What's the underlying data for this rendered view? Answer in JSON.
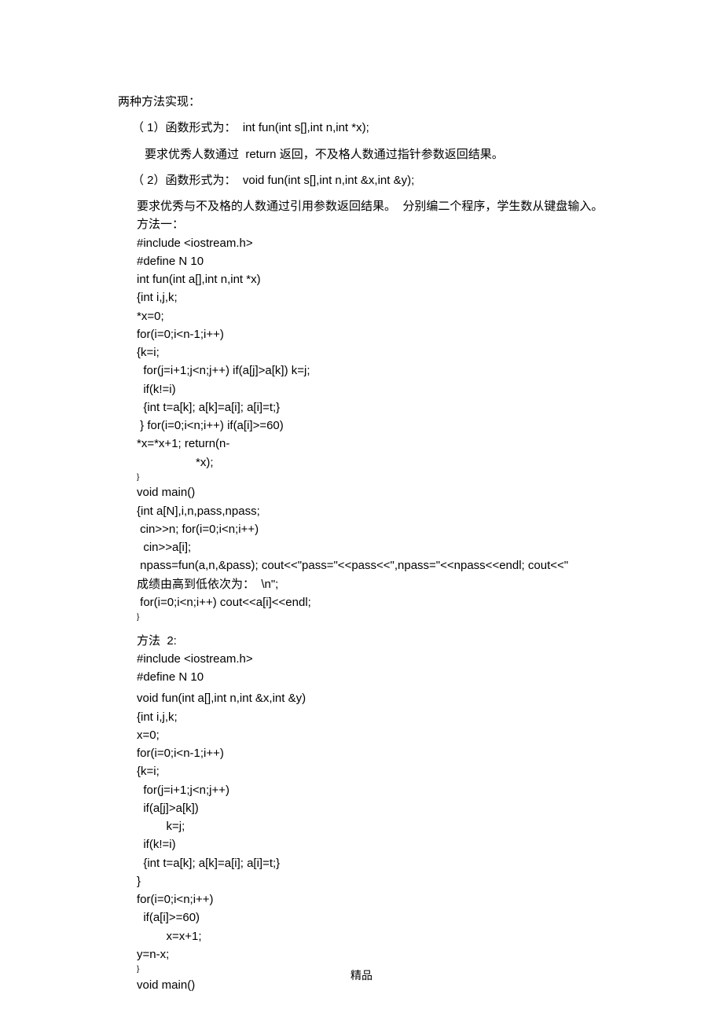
{
  "intro": "两种方法实现：",
  "item1_a": "（ 1）函数形式为：  int fun(int s[],int n,int *x);",
  "item1_b": "要求优秀人数通过  return 返回，不及格人数通过指针参数返回结果。",
  "item2_a": "（ 2）函数形式为：  void fun(int s[],int n,int &x,int &y);",
  "item2_b": "要求优秀与不及格的人数通过引用参数返回结果。  分别编二个程序，学生数从键盘输入。",
  "m1_label": "方法一：",
  "m1_code": [
    "#include <iostream.h>",
    "#define N 10",
    "int fun(int a[],int n,int *x)",
    "{int i,j,k;",
    "*x=0;",
    "for(i=0;i<n-1;i++)",
    "{k=i;",
    "  for(j=i+1;j<n;j++) if(a[j]>a[k]) k=j;",
    "  if(k!=i)",
    "  {int t=a[k]; a[k]=a[i]; a[i]=t;}",
    " } for(i=0;i<n;i++) if(a[i]>=60)",
    "*x=*x+1; return(n-",
    "                  *x);",
    "}",
    "void main()",
    "{int a[N],i,n,pass,npass;",
    " cin>>n; for(i=0;i<n;i++)",
    "  cin>>a[i];",
    " npass=fun(a,n,&pass); cout<<\"pass=\"<<pass<<\",npass=\"<<npass<<endl; cout<<\"",
    "成绩由高到低依次为：  \\n\";",
    " for(i=0;i<n;i++) cout<<a[i]<<endl;",
    "}"
  ],
  "m2_label": "方法  2:",
  "m2_code": [
    "#include <iostream.h>",
    "#define N 10",
    "void fun(int a[],int n,int &x,int &y)",
    "{int i,j,k;",
    "x=0;",
    "for(i=0;i<n-1;i++)",
    "{k=i;",
    "  for(j=i+1;j<n;j++)",
    "  if(a[j]>a[k])",
    "         k=j;",
    "  if(k!=i)",
    "  {int t=a[k]; a[k]=a[i]; a[i]=t;}",
    "}",
    "for(i=0;i<n;i++)",
    "  if(a[i]>=60)",
    "         x=x+1;",
    "y=n-x;",
    "}",
    "void main()"
  ],
  "footer": "精品"
}
